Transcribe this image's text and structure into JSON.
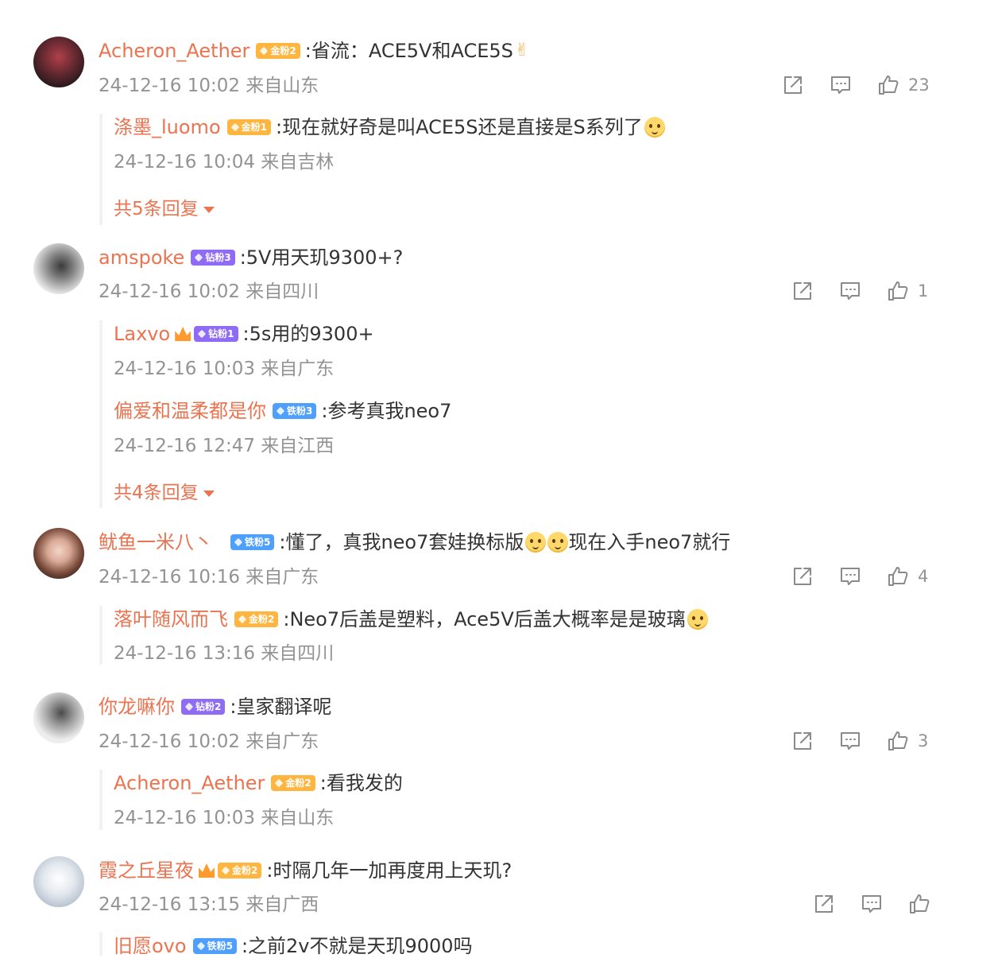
{
  "colors": {
    "username": "#eb7350",
    "meta": "#939393",
    "gold": "#ffb640",
    "purple": "#8f6cf5",
    "blue": "#4f9fff"
  },
  "comments": [
    {
      "user": "Acheron_Aether",
      "badge": "金粉2",
      "badge_color": "gold",
      "text": ":省流：ACE5V和ACE5S",
      "suffix": "victory-hand-emoji",
      "meta": "24-12-16 10:02 来自山东",
      "likes": "23",
      "replies": [
        {
          "user": "涤墨_luomo",
          "badge": "金粉1",
          "badge_color": "gold",
          "text": ":现在就好奇是叫ACE5S还是直接是S系列了",
          "meta": "24-12-16 10:04 来自吉林"
        }
      ],
      "more": "共5条回复"
    },
    {
      "user": "amspoke",
      "badge": "钻粉3",
      "badge_color": "purple",
      "text": ":5V用天玑9300+?",
      "meta": "24-12-16 10:02 来自四川",
      "likes": "1",
      "replies": [
        {
          "user": "Laxvo",
          "badge": "钻粉1",
          "badge_color": "purple",
          "text": ":5s用的9300+",
          "meta": "24-12-16 10:03 来自广东"
        },
        {
          "user": "偏爱和温柔都是你",
          "badge": "铁粉3",
          "badge_color": "blue",
          "text": ":参考真我neo7",
          "meta": "24-12-16 12:47 来自江西"
        }
      ],
      "more": "共4条回复"
    },
    {
      "user": "鱿鱼一米八丶",
      "badge": "铁粉5",
      "badge_color": "blue",
      "text": ":懂了，真我neo7套娃换标版",
      "text2": "现在入手neo7就行",
      "meta": "24-12-16 10:16 来自广东",
      "likes": "4",
      "replies": [
        {
          "user": "落叶随风而飞",
          "badge": "金粉2",
          "badge_color": "gold",
          "text": ":Neo7后盖是塑料，Ace5V后盖大概率是是玻璃",
          "meta": "24-12-16 13:16 来自四川"
        }
      ]
    },
    {
      "user": "你龙嘛你",
      "badge": "钻粉2",
      "badge_color": "purple",
      "text": ":皇家翻译呢",
      "meta": "24-12-16 10:02 来自广东",
      "likes": "3",
      "replies": [
        {
          "user": "Acheron_Aether",
          "badge": "金粉2",
          "badge_color": "gold",
          "text": ":看我发的",
          "meta": "24-12-16 10:03 来自山东"
        }
      ]
    },
    {
      "user": "霞之丘星夜",
      "badge": "金粉2",
      "badge_color": "gold",
      "text": ":时隔几年一加再度用上天玑?",
      "meta": "24-12-16 13:15 来自广西",
      "likes": "",
      "replies": [
        {
          "user": "旧愿ovo",
          "badge": "铁粉5",
          "badge_color": "blue",
          "text": ":之前2v不就是天玑9000吗",
          "meta": ""
        }
      ]
    }
  ]
}
